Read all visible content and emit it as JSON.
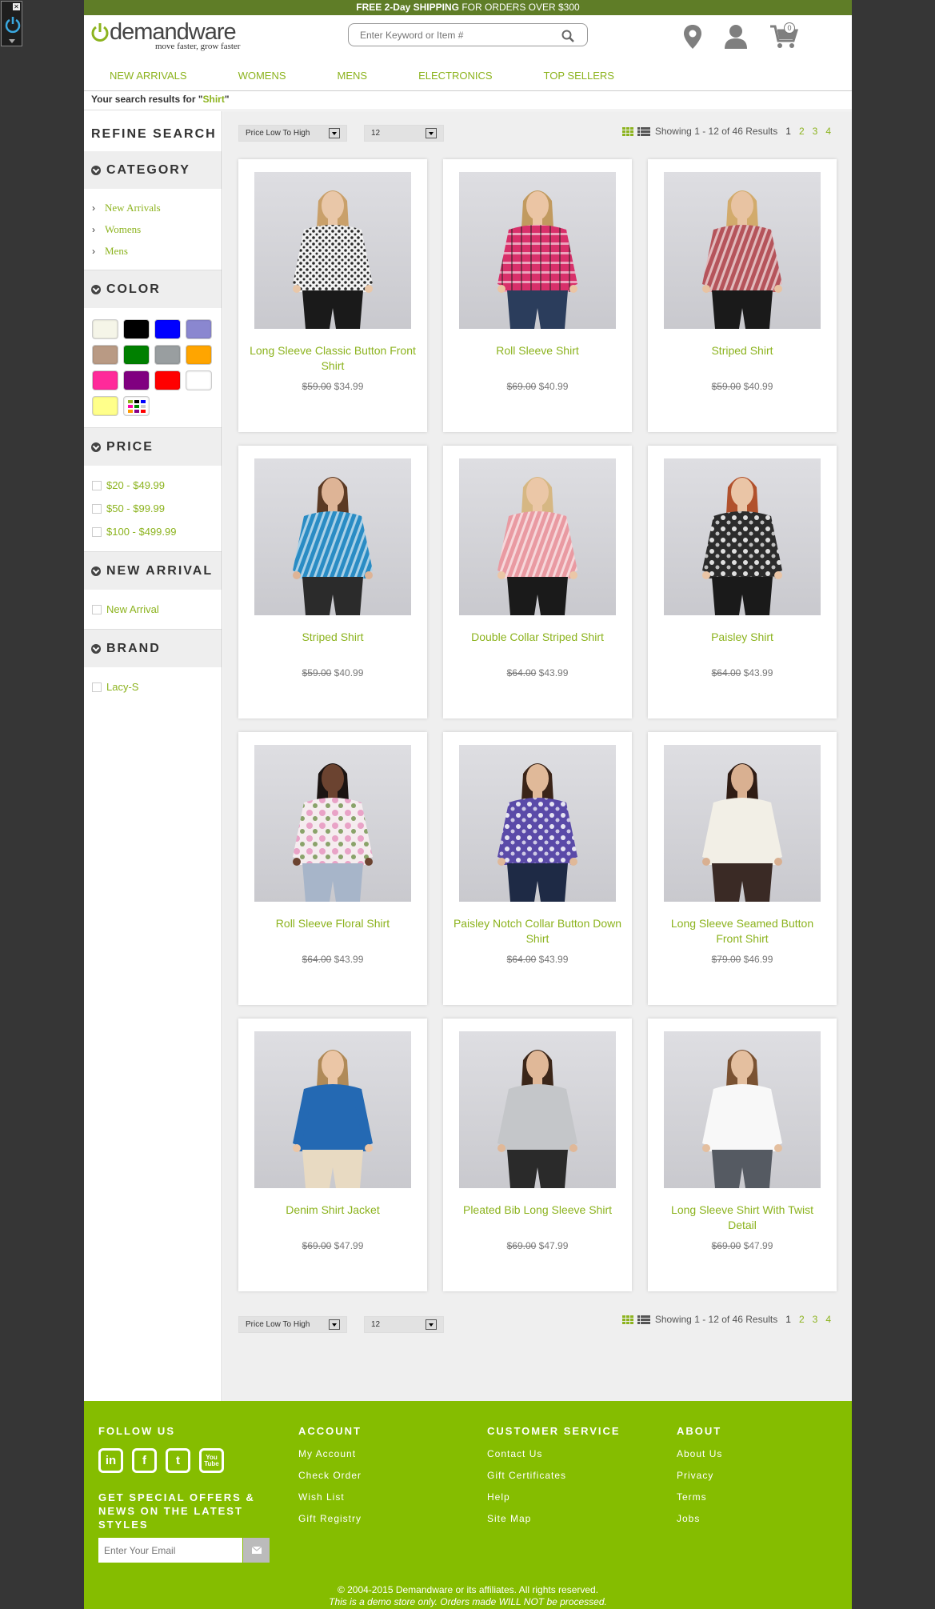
{
  "promo": {
    "bold": "FREE 2-Day SHIPPING",
    "rest": " FOR ORDERS OVER $300"
  },
  "logo": {
    "brand": "demandware",
    "tagline": "move faster, grow faster"
  },
  "search": {
    "placeholder": "Enter Keyword or Item #"
  },
  "header": {
    "cart_count": "0"
  },
  "nav": [
    "NEW ARRIVALS",
    "WOMENS",
    "MENS",
    "ELECTRONICS",
    "TOP SELLERS"
  ],
  "results": {
    "prefix": "Your search results for \"",
    "query": "Shirt",
    "suffix": "\""
  },
  "refinements": {
    "title": "REFINE SEARCH",
    "category": {
      "title": "CATEGORY",
      "items": [
        "New Arrivals",
        "Womens",
        "Mens"
      ]
    },
    "color": {
      "title": "COLOR",
      "swatches": [
        "#f5f5e8",
        "#000000",
        "#0000ff",
        "#8a87d0",
        "#b99a84",
        "#008000",
        "#999ea0",
        "#ffa500",
        "#ff2a9a",
        "#800080",
        "#ff0000",
        "#ffffff",
        "#ffff8a",
        "multi"
      ]
    },
    "price": {
      "title": "PRICE",
      "items": [
        "$20 - $49.99",
        "$50 - $99.99",
        "$100 - $499.99"
      ]
    },
    "new_arrival": {
      "title": "NEW ARRIVAL",
      "items": [
        "New Arrival"
      ]
    },
    "brand": {
      "title": "BRAND",
      "items": [
        "Lacy-S"
      ]
    }
  },
  "toolbar": {
    "sort": "Price Low To High",
    "page_size": "12",
    "showing": "Showing 1 - 12 of 46 Results",
    "pages": [
      "1",
      "2",
      "3",
      "4"
    ],
    "current_page": "1"
  },
  "products": [
    {
      "name": "Long Sleeve Classic Button Front Shirt",
      "old": "$59.00",
      "price": "$34.99",
      "shirt": "#2a2a2a",
      "pattern": "dots",
      "pants": "#1a1a1a",
      "skin": "#e9c7a8",
      "hair": "#c9a06a"
    },
    {
      "name": "Roll Sleeve Shirt",
      "old": "$69.00",
      "price": "$40.99",
      "shirt": "#d8306a",
      "pattern": "plaid",
      "pants": "#2b3d5c",
      "skin": "#ebc5a4",
      "hair": "#c19a5f"
    },
    {
      "name": "Striped Shirt",
      "old": "$59.00",
      "price": "$40.99",
      "shirt": "#b5545b",
      "pattern": "stripes",
      "pants": "#1a1a1a",
      "skin": "#e8c3a2",
      "hair": "#d2ab6c"
    },
    {
      "name": "Striped Shirt",
      "old": "$59.00",
      "price": "$40.99",
      "shirt": "#2a8cc4",
      "pattern": "stripes",
      "pants": "#2b2b2b",
      "skin": "#deb496",
      "hair": "#5b3a24"
    },
    {
      "name": "Double Collar Striped Shirt",
      "old": "$64.00",
      "price": "$43.99",
      "shirt": "#e99aa2",
      "pattern": "stripes",
      "pants": "#1a1a1a",
      "skin": "#ebc7a7",
      "hair": "#d6b783"
    },
    {
      "name": "Paisley Shirt",
      "old": "$64.00",
      "price": "$43.99",
      "shirt": "#2c2c2c",
      "pattern": "paisley",
      "pants": "#1a1a1a",
      "skin": "#eac5a6",
      "hair": "#b1512c"
    },
    {
      "name": "Roll Sleeve Floral Shirt",
      "old": "$64.00",
      "price": "$43.99",
      "shirt": "#e9a3c7",
      "pattern": "floral",
      "pants": "#a7b5c9",
      "skin": "#6b4330",
      "hair": "#1b1412"
    },
    {
      "name": "Paisley Notch Collar Button Down Shirt",
      "old": "$64.00",
      "price": "$43.99",
      "shirt": "#5a4aa8",
      "pattern": "paisley",
      "pants": "#1e2a45",
      "skin": "#e0b999",
      "hair": "#3a2418"
    },
    {
      "name": "Long Sleeve Seamed Button Front Shirt",
      "old": "$79.00",
      "price": "$46.99",
      "shirt": "#f2efe6",
      "pattern": "plain",
      "pants": "#3a2a25",
      "skin": "#d9b091",
      "hair": "#2f1c14"
    },
    {
      "name": "Denim Shirt Jacket",
      "old": "$69.00",
      "price": "$47.99",
      "shirt": "#2469b3",
      "pattern": "plain",
      "pants": "#e8dac2",
      "skin": "#ebc6a6",
      "hair": "#b08a58"
    },
    {
      "name": "Pleated Bib Long Sleeve Shirt",
      "old": "$69.00",
      "price": "$47.99",
      "shirt": "#c4c6c9",
      "pattern": "plain",
      "pants": "#2a2a2a",
      "skin": "#e0b898",
      "hair": "#3b2619"
    },
    {
      "name": "Long Sleeve Shirt With Twist Detail",
      "old": "$69.00",
      "price": "$47.99",
      "shirt": "#f8f8f8",
      "pattern": "plain",
      "pants": "#555a62",
      "skin": "#e4bf9f",
      "hair": "#7a5232"
    }
  ],
  "footer": {
    "follow": "FOLLOW US",
    "social": [
      "in",
      "f",
      "t",
      "You Tube"
    ],
    "offers": "GET SPECIAL OFFERS & NEWS ON THE LATEST STYLES",
    "email_placeholder": "Enter Your Email",
    "account": {
      "title": "ACCOUNT",
      "links": [
        "My Account",
        "Check Order",
        "Wish List",
        "Gift Registry"
      ]
    },
    "service": {
      "title": "CUSTOMER SERVICE",
      "links": [
        "Contact Us",
        "Gift Certificates",
        "Help",
        "Site Map"
      ]
    },
    "about": {
      "title": "ABOUT",
      "links": [
        "About Us",
        "Privacy",
        "Terms",
        "Jobs"
      ]
    },
    "copyright": "© 2004-2015 Demandware or its affiliates. All rights reserved.",
    "disclaimer": "This is a demo store only. Orders made WILL NOT be processed."
  },
  "colors": {
    "accent": "#8cb31e",
    "promo_bg": "#5f7d27",
    "footer_bg": "#85bd00"
  }
}
